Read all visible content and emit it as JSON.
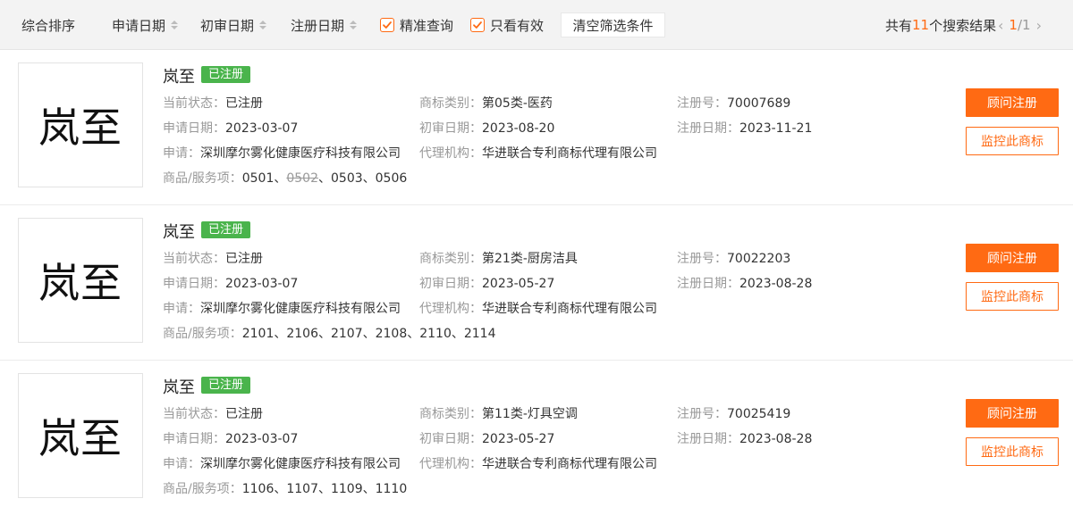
{
  "toolbar": {
    "sort_label": "综合排序",
    "apply_date_label": "申请日期",
    "prelim_date_label": "初审日期",
    "reg_date_label": "注册日期",
    "exact_query_label": "精准查询",
    "valid_only_label": "只看有效",
    "clear_label": "清空筛选条件",
    "result_prefix": "共有",
    "result_count": "11",
    "result_suffix": "个搜索结果",
    "page_current": "1",
    "page_sep": "/",
    "page_total": "1",
    "accent_color": "#ff6a13"
  },
  "labels": {
    "status": "当前状态：",
    "category": "商标类别：",
    "reg_no": "注册号：",
    "apply_date": "申请日期：",
    "prelim_date": "初审日期：",
    "reg_date": "注册日期：",
    "applicant": "申请：",
    "agency": "代理机构：",
    "goods": "商品/服务项：",
    "consult_btn": "顾问注册",
    "monitor_btn": "监控此商标"
  },
  "results": [
    {
      "logo_text": "岚至",
      "name": "岚至",
      "badge": "已注册",
      "status": "已注册",
      "category": "第05类-医药",
      "reg_no": "70007689",
      "apply_date": "2023-03-07",
      "prelim_date": "2023-08-20",
      "reg_date": "2023-11-21",
      "applicant": "深圳摩尔雾化健康医疗科技有限公司",
      "agency": "华进联合专利商标代理有限公司",
      "goods_a": "0501、",
      "goods_struck": "0502",
      "goods_b": "、0503、0506"
    },
    {
      "logo_text": "岚至",
      "name": "岚至",
      "badge": "已注册",
      "status": "已注册",
      "category": "第21类-厨房洁具",
      "reg_no": "70022203",
      "apply_date": "2023-03-07",
      "prelim_date": "2023-05-27",
      "reg_date": "2023-08-28",
      "applicant": "深圳摩尔雾化健康医疗科技有限公司",
      "agency": "华进联合专利商标代理有限公司",
      "goods": "2101、2106、2107、2108、2110、2114"
    },
    {
      "logo_text": "岚至",
      "name": "岚至",
      "badge": "已注册",
      "status": "已注册",
      "category": "第11类-灯具空调",
      "reg_no": "70025419",
      "apply_date": "2023-03-07",
      "prelim_date": "2023-05-27",
      "reg_date": "2023-08-28",
      "applicant": "深圳摩尔雾化健康医疗科技有限公司",
      "agency": "华进联合专利商标代理有限公司",
      "goods": "1106、1107、1109、1110"
    }
  ]
}
